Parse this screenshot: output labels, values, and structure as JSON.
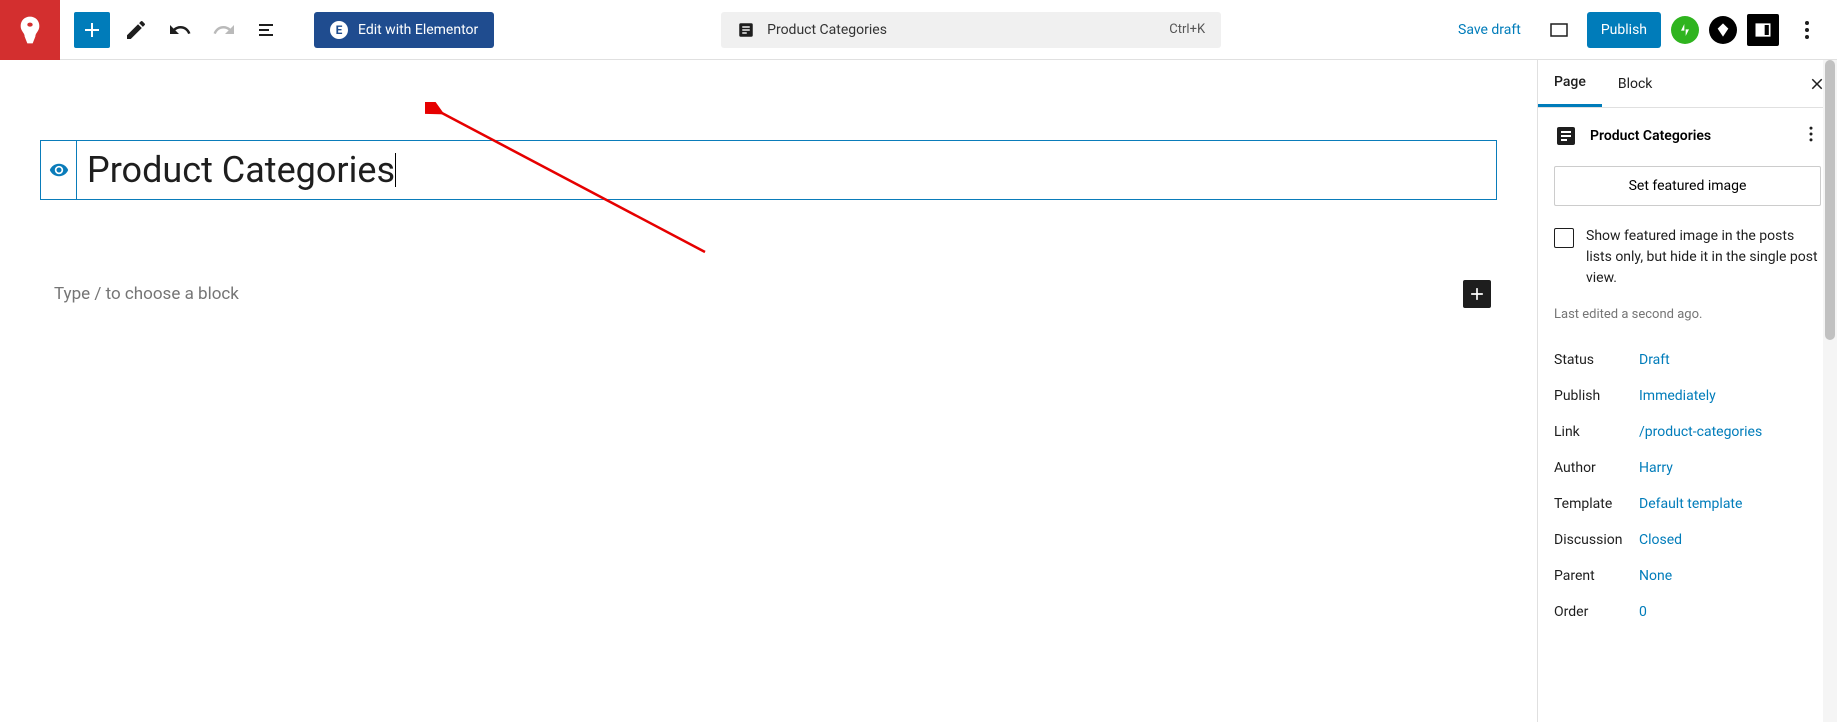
{
  "toolbar": {
    "elementor_label": "Edit with Elementor",
    "doc_title": "Product Categories",
    "shortcut": "Ctrl+K",
    "save_draft_label": "Save draft",
    "publish_label": "Publish"
  },
  "editor": {
    "title": "Product Categories",
    "block_placeholder": "Type / to choose a block"
  },
  "sidebar": {
    "tabs": {
      "page": "Page",
      "block": "Block"
    },
    "page_title": "Product Categories",
    "featured_button": "Set featured image",
    "hide_featured_label": "Show featured image in the posts lists only, but hide it in the single post view.",
    "last_edited": "Last edited a second ago.",
    "meta": {
      "status_label": "Status",
      "status_value": "Draft",
      "publish_label": "Publish",
      "publish_value": "Immediately",
      "link_label": "Link",
      "link_value": "/product-categories",
      "author_label": "Author",
      "author_value": "Harry",
      "template_label": "Template",
      "template_value": "Default template",
      "discussion_label": "Discussion",
      "discussion_value": "Closed",
      "parent_label": "Parent",
      "parent_value": "None",
      "order_label": "Order",
      "order_value": "0"
    }
  }
}
